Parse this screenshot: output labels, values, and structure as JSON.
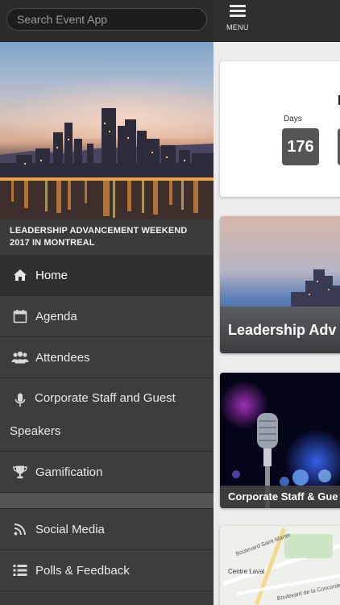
{
  "search": {
    "placeholder": "Search Event App"
  },
  "event": {
    "title": "LEADERSHIP ADVANCEMENT WEEKEND 2017 IN MONTREAL"
  },
  "nav": {
    "items": [
      {
        "label": "Home",
        "icon": "home-icon"
      },
      {
        "label": "Agenda",
        "icon": "calendar-icon"
      },
      {
        "label": "Attendees",
        "icon": "people-icon"
      },
      {
        "label": "Corporate Staff and Guest",
        "label_line2": "Speakers",
        "icon": "microphone-icon"
      },
      {
        "label": "Gamification",
        "icon": "trophy-icon"
      },
      {
        "label": "Social Media",
        "icon": "rss-icon"
      },
      {
        "label": "Polls & Feedback",
        "icon": "list-icon"
      }
    ]
  },
  "topbar": {
    "menu_label": "MENU"
  },
  "countdown": {
    "days_label": "Days",
    "days_value": "176"
  },
  "tiles": {
    "leadership_caption": "Leadership Adv",
    "staff_caption": "Corporate Staff & Gue",
    "map_labels": [
      "Centre Laval",
      "Boulevard Saint-Martin",
      "Boulevard de la Concorde O"
    ]
  },
  "colors": {
    "drawer_bg": "#3b3b3b",
    "topbar_bg": "#2f2f2f",
    "countdown_box": "#555555"
  }
}
